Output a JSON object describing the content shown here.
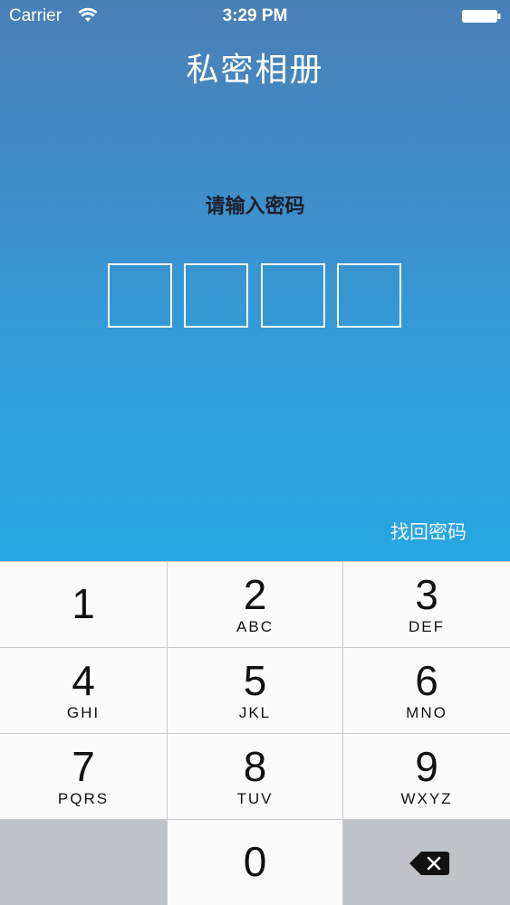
{
  "status_bar": {
    "carrier": "Carrier",
    "time": "3:29 PM",
    "icons": [
      "wifi-icon",
      "battery-icon"
    ]
  },
  "app": {
    "title": "私密相册",
    "prompt": "请输入密码",
    "pin_length": 4,
    "recover_link": "找回密码"
  },
  "keypad": {
    "keys": [
      {
        "digit": "1",
        "letters": ""
      },
      {
        "digit": "2",
        "letters": "ABC"
      },
      {
        "digit": "3",
        "letters": "DEF"
      },
      {
        "digit": "4",
        "letters": "GHI"
      },
      {
        "digit": "5",
        "letters": "JKL"
      },
      {
        "digit": "6",
        "letters": "MNO"
      },
      {
        "digit": "7",
        "letters": "PQRS"
      },
      {
        "digit": "8",
        "letters": "TUV"
      },
      {
        "digit": "9",
        "letters": "WXYZ"
      },
      {
        "digit": "0",
        "letters": ""
      }
    ],
    "backspace_icon": "backspace-icon"
  },
  "colors": {
    "gradient_top": "#4a7fb6",
    "gradient_bottom": "#28a6e1",
    "keypad_key": "#fbfbfb",
    "keypad_gray_key": "#bfc3c7"
  }
}
